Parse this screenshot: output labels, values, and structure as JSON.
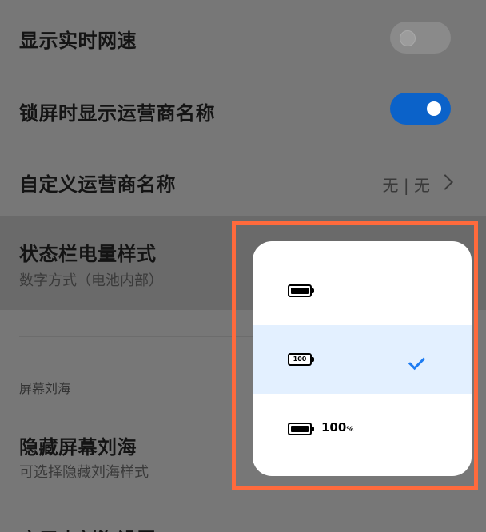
{
  "settings": {
    "realtime_speed": {
      "label": "显示实时网速",
      "enabled": false
    },
    "lockscreen_carrier": {
      "label": "锁屏时显示运营商名称",
      "enabled": true
    },
    "custom_carrier": {
      "label": "自定义运营商名称",
      "value": "无 | 无"
    },
    "battery_style": {
      "label": "状态栏电量样式",
      "subtitle": "数字方式（电池内部）"
    },
    "notch_section": "屏幕刘海",
    "hide_notch": {
      "label": "隐藏屏幕刘海",
      "subtitle": "可选择隐藏刘海样式"
    },
    "app_notch": {
      "label": "应用内刘海设置"
    }
  },
  "battery_popup": {
    "options": [
      {
        "icon": "battery-filled-icon",
        "text": "",
        "selected": false
      },
      {
        "icon": "battery-number-inside-icon",
        "text": "100",
        "selected": true
      },
      {
        "icon": "battery-filled-icon",
        "text": "100",
        "unit": "%",
        "selected": false
      }
    ]
  },
  "colors": {
    "accent": "#0b62c9",
    "check": "#1d7cf2",
    "highlight_frame": "#ff6a3c"
  }
}
